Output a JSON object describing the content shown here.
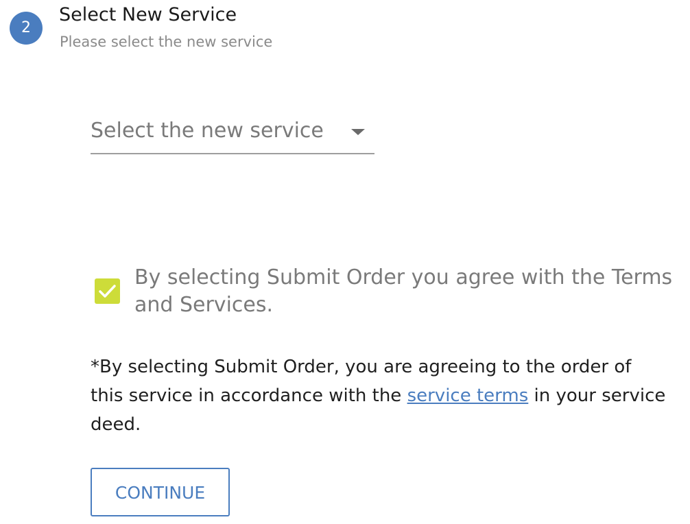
{
  "step": {
    "number": "2",
    "title": "Select New Service",
    "subtitle": "Please select the new service"
  },
  "service_select": {
    "placeholder": "Select the new service",
    "arrow_icon": "caret-down-icon"
  },
  "agreement": {
    "checked": true,
    "checkbox_color": "#cddc39",
    "check_icon": "check-icon",
    "label": "By selecting Submit Order you agree with the Terms and Services."
  },
  "legal": {
    "text_before": "*By selecting Submit Order, you are agreeing to the order of this service in accordance with the ",
    "link_label": "service terms",
    "text_after": " in your service deed."
  },
  "continue_button": {
    "label": "CONTINUE"
  },
  "colors": {
    "accent": "#4a7dbf",
    "checkbox": "#cddc39",
    "muted_text": "#7a7a7a"
  }
}
